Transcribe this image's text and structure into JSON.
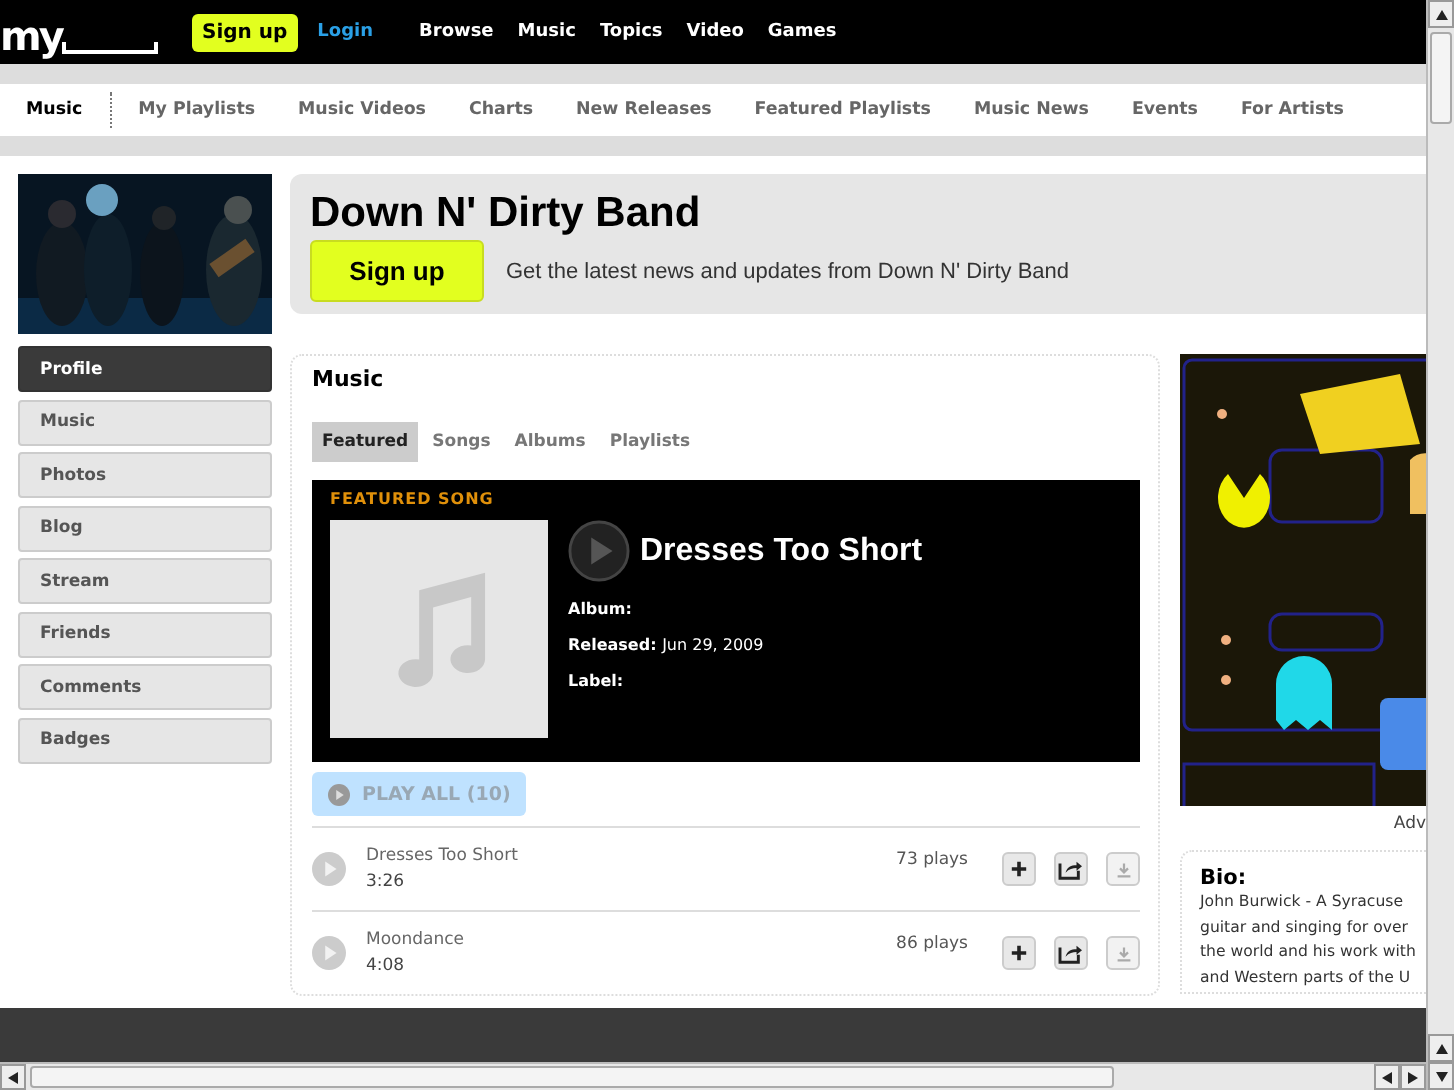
{
  "top_bar": {
    "logo": "my",
    "signup": "Sign up",
    "login": "Login",
    "links": [
      "Browse",
      "Music",
      "Topics",
      "Video",
      "Games"
    ]
  },
  "music_nav": [
    {
      "label": "Music",
      "selected": true
    },
    {
      "label": "My Playlists",
      "selected": false
    },
    {
      "label": "Music Videos",
      "selected": false
    },
    {
      "label": "Charts",
      "selected": false
    },
    {
      "label": "New Releases",
      "selected": false
    },
    {
      "label": "Featured Playlists",
      "selected": false
    },
    {
      "label": "Music News",
      "selected": false
    },
    {
      "label": "Events",
      "selected": false
    },
    {
      "label": "For Artists",
      "selected": false
    }
  ],
  "profile": {
    "name": "Down N' Dirty Band",
    "signup": "Sign up",
    "tagline": "Get the latest news and updates from Down N' Dirty Band"
  },
  "sidebar": [
    {
      "label": "Profile",
      "selected": true
    },
    {
      "label": "Music",
      "selected": false
    },
    {
      "label": "Photos",
      "selected": false
    },
    {
      "label": "Blog",
      "selected": false
    },
    {
      "label": "Stream",
      "selected": false
    },
    {
      "label": "Friends",
      "selected": false
    },
    {
      "label": "Comments",
      "selected": false
    },
    {
      "label": "Badges",
      "selected": false
    }
  ],
  "music": {
    "title": "Music",
    "tabs": [
      {
        "label": "Featured",
        "selected": true
      },
      {
        "label": "Songs",
        "selected": false
      },
      {
        "label": "Albums",
        "selected": false
      },
      {
        "label": "Playlists",
        "selected": false
      }
    ],
    "featured": {
      "heading": "FEATURED SONG",
      "title": "Dresses Too Short",
      "album_label": "Album:",
      "released_label": "Released:",
      "released": "Jun 29, 2009",
      "label_label": "Label:"
    },
    "play_all": {
      "label": "PLAY ALL (10)",
      "disabled": true
    },
    "songs": [
      {
        "title": "Dresses Too Short",
        "duration": "3:26",
        "plays": "73 plays"
      },
      {
        "title": "Moondance",
        "duration": "4:08",
        "plays": "86 plays"
      }
    ]
  },
  "ad": {
    "kind": "picture",
    "caption": "Adv"
  },
  "bio": {
    "title": "Bio:",
    "lines": [
      "John Burwick - A Syracuse",
      "guitar and singing for over",
      "the world and his work with",
      "and Western parts of the U"
    ]
  }
}
